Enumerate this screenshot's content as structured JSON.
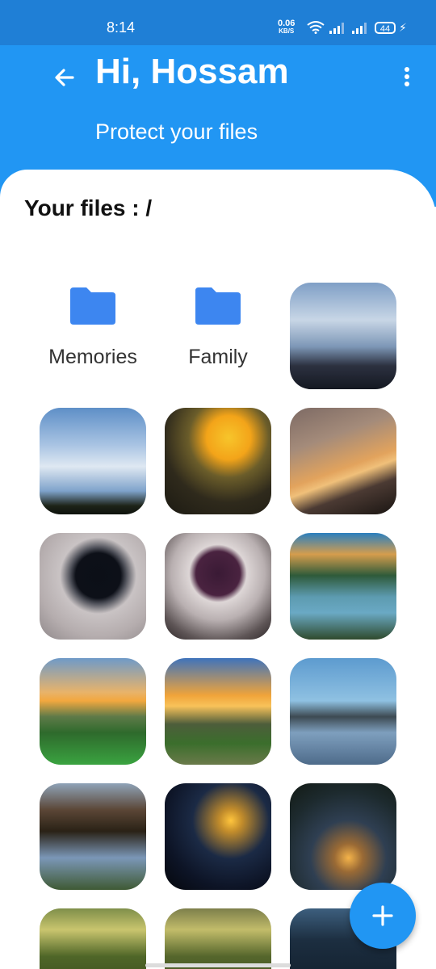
{
  "status_bar": {
    "time": "8:14",
    "net_speed": "0.06",
    "net_unit": "KB/S",
    "battery": "44"
  },
  "header": {
    "greeting": "Hi, Hossam",
    "subtitle": "Protect your files",
    "accent_color": "#2196f3",
    "status_color": "#1f7fd6"
  },
  "main": {
    "title": "Your files : /",
    "folders": [
      {
        "name": "Memories",
        "icon": "folder-icon"
      },
      {
        "name": "Family",
        "icon": "folder-icon"
      }
    ],
    "photos": [
      {
        "subject": "cloudy sky over water"
      },
      {
        "subject": "blue sky with clouds"
      },
      {
        "subject": "yellow flower"
      },
      {
        "subject": "sunset sky"
      },
      {
        "subject": "coffee cup"
      },
      {
        "subject": "tea cup"
      },
      {
        "subject": "garden path"
      },
      {
        "subject": "green field at sunset"
      },
      {
        "subject": "sunset over garden"
      },
      {
        "subject": "lake at dusk"
      },
      {
        "subject": "tree over water"
      },
      {
        "subject": "sunset silhouette"
      },
      {
        "subject": "sunset through trees"
      },
      {
        "subject": "leaves"
      },
      {
        "subject": "leaves"
      },
      {
        "subject": "dark sky"
      }
    ]
  },
  "fab": {
    "icon": "plus-icon"
  }
}
